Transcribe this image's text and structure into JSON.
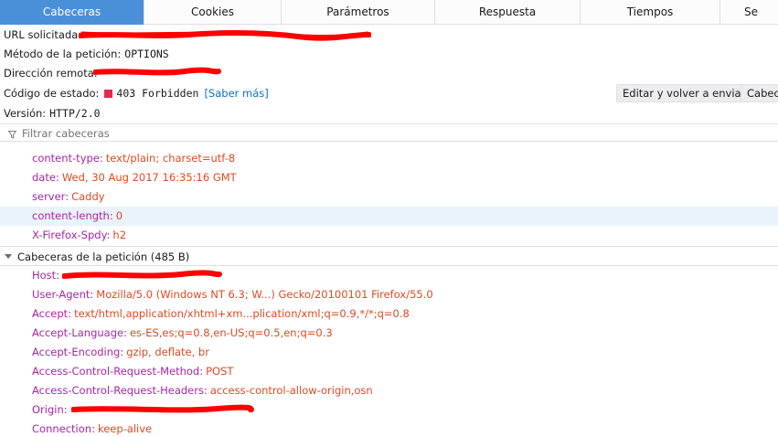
{
  "tabs": [
    "Cabeceras",
    "Cookies",
    "Parámetros",
    "Respuesta",
    "Tiempos",
    "Se"
  ],
  "summary": {
    "url_label": "URL solicitada:",
    "method_label": "Método de la petición:",
    "method_value": "OPTIONS",
    "remote_label": "Dirección remota:",
    "status_label": "Código de estado:",
    "status_value": "403 Forbidden",
    "status_link": "[Saber más]",
    "version_label": "Versión:",
    "version_value": "HTTP/2.0",
    "edit_button": "Editar y volver a enviar",
    "raw_button": "Cabec"
  },
  "filter": {
    "placeholder": "Filtrar cabeceras"
  },
  "response_headers": [
    {
      "name": "content-type",
      "value": "text/plain; charset=utf-8"
    },
    {
      "name": "date",
      "value": "Wed, 30 Aug 2017 16:35:16 GMT"
    },
    {
      "name": "server",
      "value": "Caddy"
    },
    {
      "name": "content-length",
      "value": "0"
    },
    {
      "name": "X-Firefox-Spdy",
      "value": "h2"
    }
  ],
  "request_section": {
    "title": "Cabeceras de la petición (485 B)"
  },
  "request_headers": [
    {
      "name": "Host",
      "value": ""
    },
    {
      "name": "User-Agent",
      "value": "Mozilla/5.0 (Windows NT 6.3; W...) Gecko/20100101 Firefox/55.0"
    },
    {
      "name": "Accept",
      "value": "text/html,application/xhtml+xm...plication/xml;q=0.9,*/*;q=0.8"
    },
    {
      "name": "Accept-Language",
      "value": "es-ES,es;q=0.8,en-US;q=0.5,en;q=0.3"
    },
    {
      "name": "Accept-Encoding",
      "value": "gzip, deflate, br"
    },
    {
      "name": "Access-Control-Request-Method",
      "value": "POST"
    },
    {
      "name": "Access-Control-Request-Headers",
      "value": "access-control-allow-origin,osn"
    },
    {
      "name": "Origin",
      "value": ""
    },
    {
      "name": "Connection",
      "value": "keep-alive"
    }
  ],
  "colors": {
    "tab_selected": "#4a90d9",
    "header_name": "#a626a4",
    "header_value": "#dd4a22",
    "status_dot": "#e0294c",
    "link": "#0a71bf",
    "redaction": "#ff0000"
  }
}
